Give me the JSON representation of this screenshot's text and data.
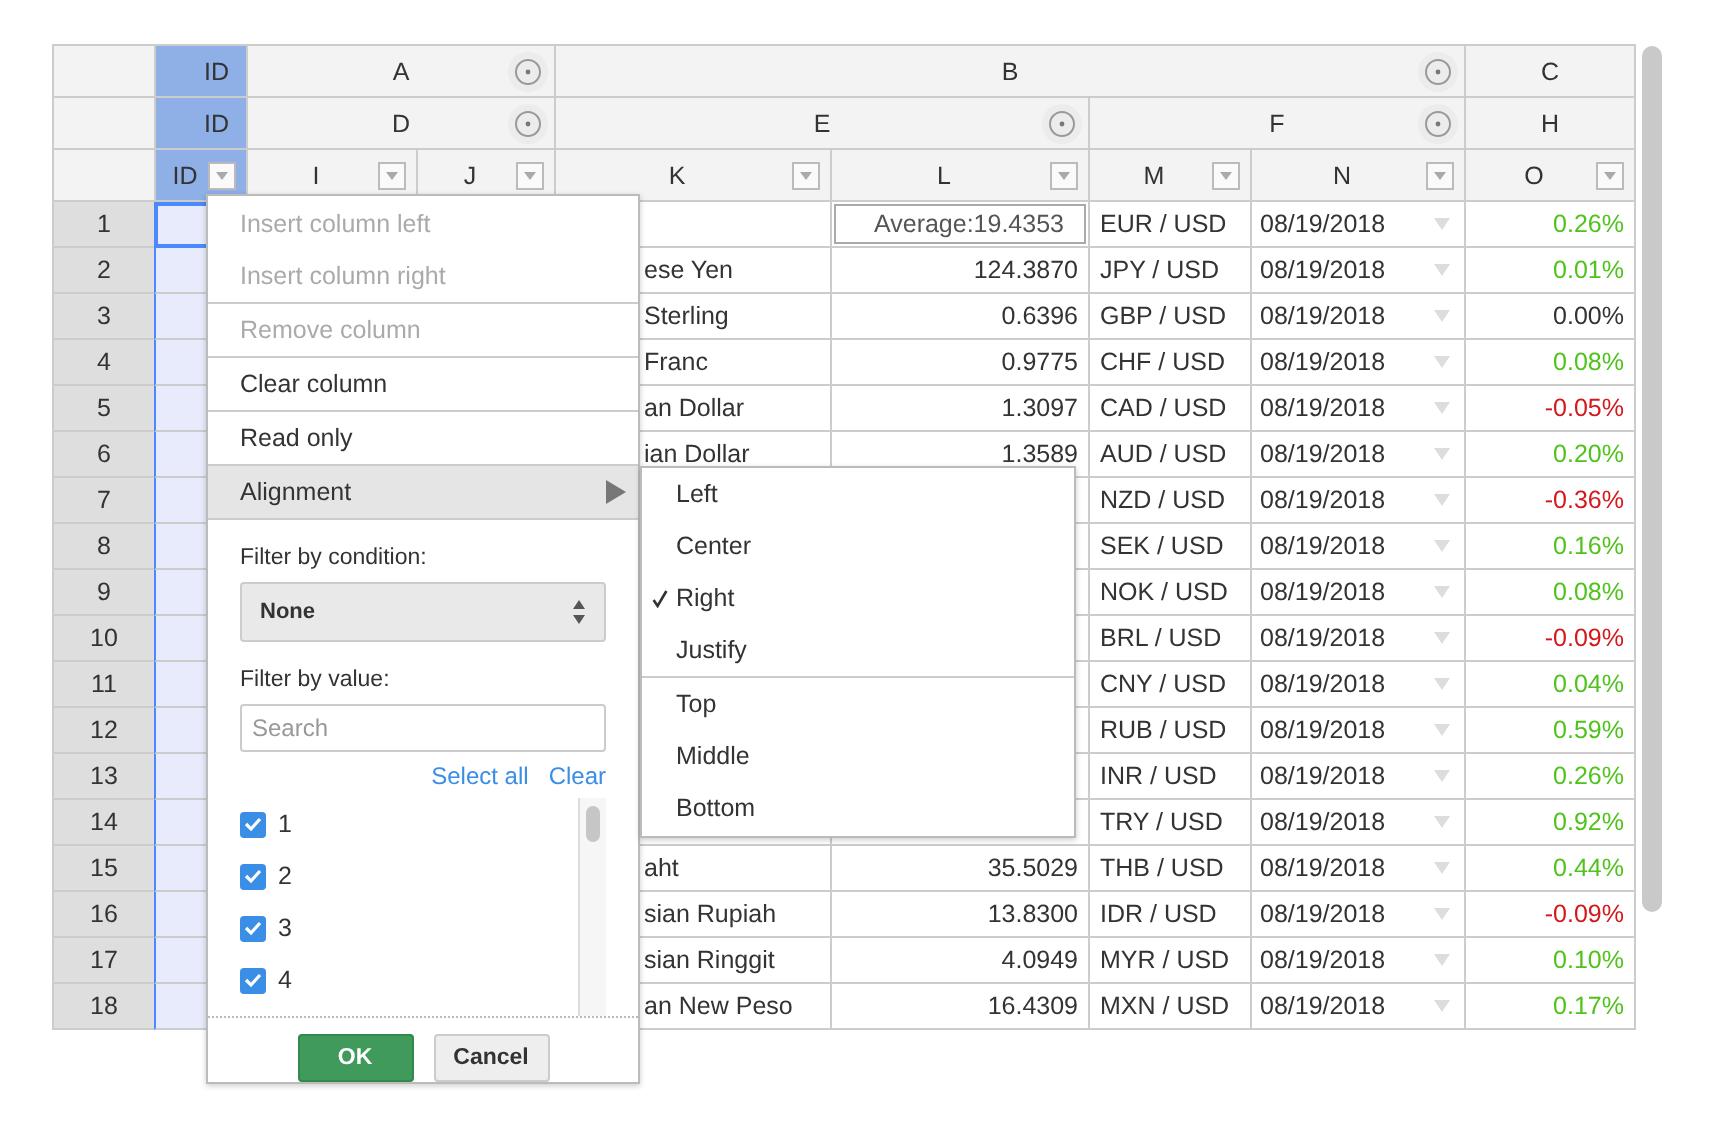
{
  "columns": [
    {
      "label": "ID",
      "selected": true,
      "collapsible": false,
      "children": [
        {
          "label": "ID",
          "selected": true,
          "collapsible": false,
          "children": [
            {
              "label": "ID",
              "selected": true
            }
          ]
        }
      ]
    },
    {
      "label": "A",
      "selected": false,
      "collapsible": true,
      "children": [
        {
          "label": "D",
          "selected": false,
          "collapsible": true,
          "children": [
            {
              "label": "I",
              "selected": false
            },
            {
              "label": "J",
              "selected": false
            }
          ]
        }
      ]
    },
    {
      "label": "B",
      "selected": false,
      "collapsible": true,
      "children": [
        {
          "label": "E",
          "selected": false,
          "collapsible": true,
          "children": [
            {
              "label": "K",
              "selected": false
            },
            {
              "label": "L",
              "selected": false
            }
          ]
        },
        {
          "label": "F",
          "selected": false,
          "collapsible": true,
          "children": [
            {
              "label": "M",
              "selected": false
            },
            {
              "label": "N",
              "selected": false
            }
          ]
        }
      ]
    },
    {
      "label": "C",
      "selected": false,
      "collapsible": false,
      "children": [
        {
          "label": "H",
          "selected": false,
          "collapsible": false,
          "children": [
            {
              "label": "O",
              "selected": false
            }
          ]
        }
      ]
    }
  ],
  "rows": [
    {
      "number": "1",
      "active": true,
      "summary": true,
      "l": "Average:19.4353",
      "m": "EUR / USD",
      "n": "08/19/2018",
      "o": "0.26%",
      "color": "#4fc31c"
    },
    {
      "number": "2",
      "active": false,
      "summary": false,
      "k": "ese Yen",
      "l": "124.3870",
      "m": "JPY / USD",
      "n": "08/19/2018",
      "o": "0.01%",
      "color": "#4fc31c"
    },
    {
      "number": "3",
      "active": false,
      "summary": false,
      "k": "Sterling",
      "l": "0.6396",
      "m": "GBP / USD",
      "n": "08/19/2018",
      "o": "0.00%",
      "color": "#333333"
    },
    {
      "number": "4",
      "active": false,
      "summary": false,
      "k": "Franc",
      "l": "0.9775",
      "m": "CHF / USD",
      "n": "08/19/2018",
      "o": "0.08%",
      "color": "#4fc31c"
    },
    {
      "number": "5",
      "active": false,
      "summary": false,
      "k": "an Dollar",
      "l": "1.3097",
      "m": "CAD / USD",
      "n": "08/19/2018",
      "o": "-0.05%",
      "color": "#d4181c"
    },
    {
      "number": "6",
      "active": false,
      "summary": false,
      "k": "ian Dollar",
      "l": "1.3589",
      "m": "AUD / USD",
      "n": "08/19/2018",
      "o": "0.20%",
      "color": "#4fc31c"
    },
    {
      "number": "7",
      "active": false,
      "m": "NZD / USD",
      "n": "08/19/2018",
      "o": "-0.36%",
      "color": "#d4181c"
    },
    {
      "number": "8",
      "active": false,
      "m": "SEK / USD",
      "n": "08/19/2018",
      "o": "0.16%",
      "color": "#4fc31c"
    },
    {
      "number": "9",
      "active": false,
      "m": "NOK / USD",
      "n": "08/19/2018",
      "o": "0.08%",
      "color": "#4fc31c"
    },
    {
      "number": "10",
      "active": false,
      "m": "BRL / USD",
      "n": "08/19/2018",
      "o": "-0.09%",
      "color": "#d4181c"
    },
    {
      "number": "11",
      "active": false,
      "m": "CNY / USD",
      "n": "08/19/2018",
      "o": "0.04%",
      "color": "#4fc31c"
    },
    {
      "number": "12",
      "active": false,
      "m": "RUB / USD",
      "n": "08/19/2018",
      "o": "0.59%",
      "color": "#4fc31c"
    },
    {
      "number": "13",
      "active": false,
      "m": "INR / USD",
      "n": "08/19/2018",
      "o": "0.26%",
      "color": "#4fc31c"
    },
    {
      "number": "14",
      "active": false,
      "summary": false,
      "m": "TRY / USD",
      "n": "08/19/2018",
      "o": "0.92%",
      "color": "#4fc31c"
    },
    {
      "number": "15",
      "active": false,
      "summary": false,
      "k": "aht",
      "l": "35.5029",
      "m": "THB / USD",
      "n": "08/19/2018",
      "o": "0.44%",
      "color": "#4fc31c"
    },
    {
      "number": "16",
      "active": false,
      "summary": false,
      "k": "sian Rupiah",
      "l": "13.8300",
      "m": "IDR / USD",
      "n": "08/19/2018",
      "o": "-0.09%",
      "color": "#d4181c"
    },
    {
      "number": "17",
      "active": false,
      "summary": false,
      "k": "sian Ringgit",
      "l": "4.0949",
      "m": "MYR / USD",
      "n": "08/19/2018",
      "o": "0.10%",
      "color": "#4fc31c"
    },
    {
      "number": "18",
      "active": false,
      "summary": false,
      "k": "an New Peso",
      "l": "16.4309",
      "m": "MXN / USD",
      "n": "08/19/2018",
      "o": "0.17%",
      "color": "#4fc31c"
    }
  ],
  "column_menu": {
    "sections": [
      [
        {
          "label": "Insert column left",
          "disabled": true,
          "highlighted": false,
          "kind": "action"
        },
        {
          "label": "Insert column right",
          "disabled": true,
          "highlighted": false,
          "kind": "action"
        }
      ],
      [
        {
          "label": "Remove column",
          "disabled": true,
          "highlighted": false,
          "kind": "action"
        }
      ],
      [
        {
          "label": "Clear column",
          "disabled": false,
          "highlighted": false,
          "kind": "action"
        }
      ],
      [
        {
          "label": "Read only",
          "disabled": false,
          "highlighted": false,
          "kind": "action"
        }
      ],
      [
        {
          "label": "Alignment",
          "disabled": false,
          "highlighted": true,
          "kind": "submenu"
        }
      ]
    ],
    "filter_by_condition": {
      "label": "Filter by condition:",
      "value": "None"
    },
    "filter_by_value": {
      "label": "Filter by value:",
      "placeholder": "Search",
      "links": [
        "Select all",
        "Clear"
      ],
      "items": [
        {
          "label": "1",
          "checked": true
        },
        {
          "label": "2",
          "checked": true
        },
        {
          "label": "3",
          "checked": true
        },
        {
          "label": "4",
          "checked": true
        }
      ]
    },
    "buttons": [
      {
        "label": "OK",
        "kind": "primary"
      },
      {
        "label": "Cancel",
        "kind": "secondary"
      }
    ]
  },
  "alignment_menu": {
    "sections": [
      [
        {
          "label": "Left",
          "selected": false
        },
        {
          "label": "Center",
          "selected": false
        },
        {
          "label": "Right",
          "selected": true
        },
        {
          "label": "Justify",
          "selected": false
        }
      ],
      [
        {
          "label": "Top",
          "selected": false
        },
        {
          "label": "Middle",
          "selected": false
        },
        {
          "label": "Bottom",
          "selected": false
        }
      ]
    ]
  }
}
